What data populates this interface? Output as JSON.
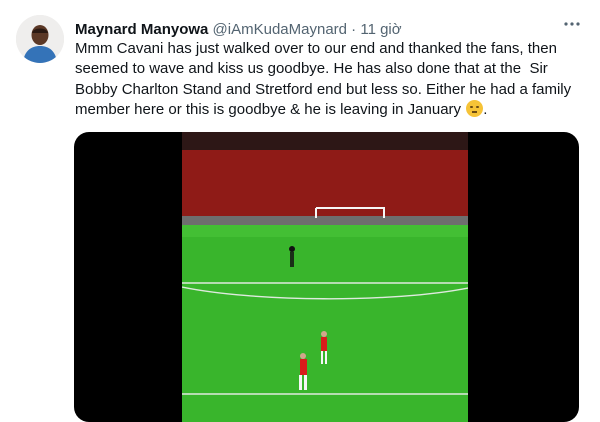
{
  "tweet": {
    "author_name": "Maynard Manyowa",
    "handle": "@iAmKudaMaynard",
    "separator": "·",
    "time": "11 giờ",
    "more_icon": "more-horizontal-icon",
    "text": "Mmm Cavani has just walked over to our end and thanked the fans, then\nseemed to wave and kiss us goodbye. He has also done that at the  Sir\nBobby Charlton Stand and Stretford end but less so. Either he had a family\nmember here or this is goodbye & he is leaving in January ",
    "text_end": ".",
    "emoji": "face-with-rolling-eyes-emoji"
  },
  "media": {
    "type": "video",
    "colors": {
      "pitch": "#39b52c",
      "stands": "#8f1b17",
      "background": "#000000"
    }
  }
}
